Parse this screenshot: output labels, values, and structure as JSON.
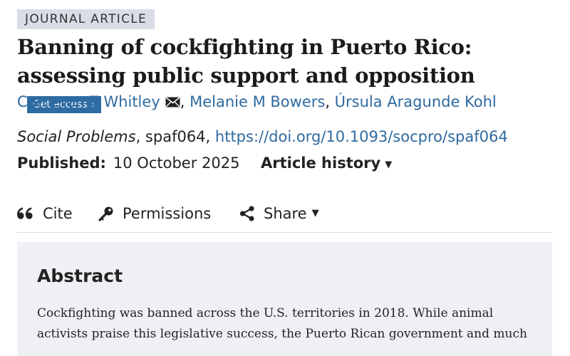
{
  "article": {
    "type_label": "JOURNAL ARTICLE",
    "title": "Banning of cockfighting in Puerto Rico: assessing public support and opposition",
    "access_button": "Get access",
    "authors": [
      "Cameron T Whitley",
      "Melanie M Bowers",
      "Úrsula Aragunde Kohl"
    ],
    "author_separator": ", ",
    "journal": "Social Problems",
    "article_id": ", spaf064, ",
    "doi": "https://doi.org/10.1093/socpro/spaf064",
    "published_label": "Published:",
    "published_date": "10 October 2025",
    "history_label": "Article history"
  },
  "toolbar": {
    "cite": "Cite",
    "permissions": "Permissions",
    "share": "Share"
  },
  "abstract": {
    "heading": "Abstract",
    "text": "Cockfighting was banned across the U.S. territories in 2018. While animal activists praise this legislative success, the Puerto Rican government and much"
  },
  "colors": {
    "link": "#2f6a9f",
    "button": "#2e6da4",
    "badge_bg": "#d8dde6",
    "abstract_bg": "#eef0f4"
  },
  "icons": [
    "mail-icon",
    "caret-down-icon",
    "quote-icon",
    "key-icon",
    "share-icon"
  ]
}
